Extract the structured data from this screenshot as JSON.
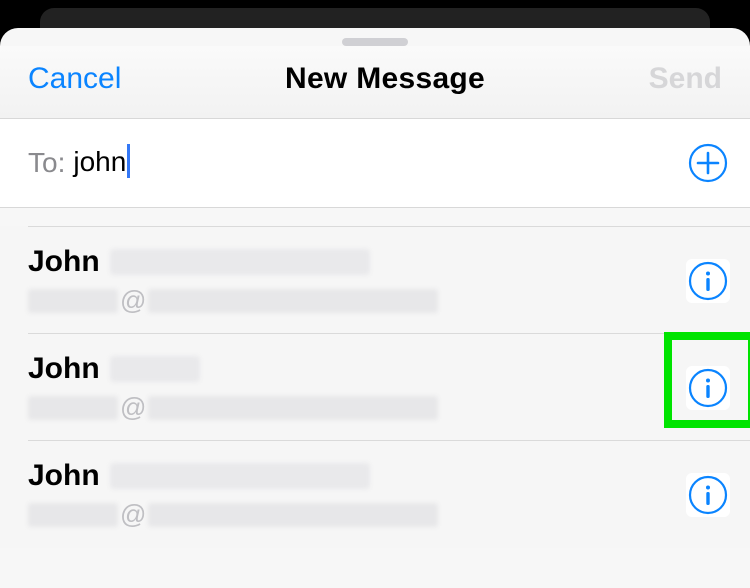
{
  "nav": {
    "cancel_label": "Cancel",
    "title": "New Message",
    "send_label": "Send"
  },
  "to_field": {
    "label": "To:",
    "value": "john"
  },
  "email_separator": "@",
  "contacts": [
    {
      "first_name": "John",
      "surname_style": "long"
    },
    {
      "first_name": "John",
      "surname_style": "short"
    },
    {
      "first_name": "John",
      "surname_style": "long"
    }
  ],
  "highlight_index": 1,
  "colors": {
    "accent": "#0a84ff",
    "highlight": "#00e400"
  }
}
